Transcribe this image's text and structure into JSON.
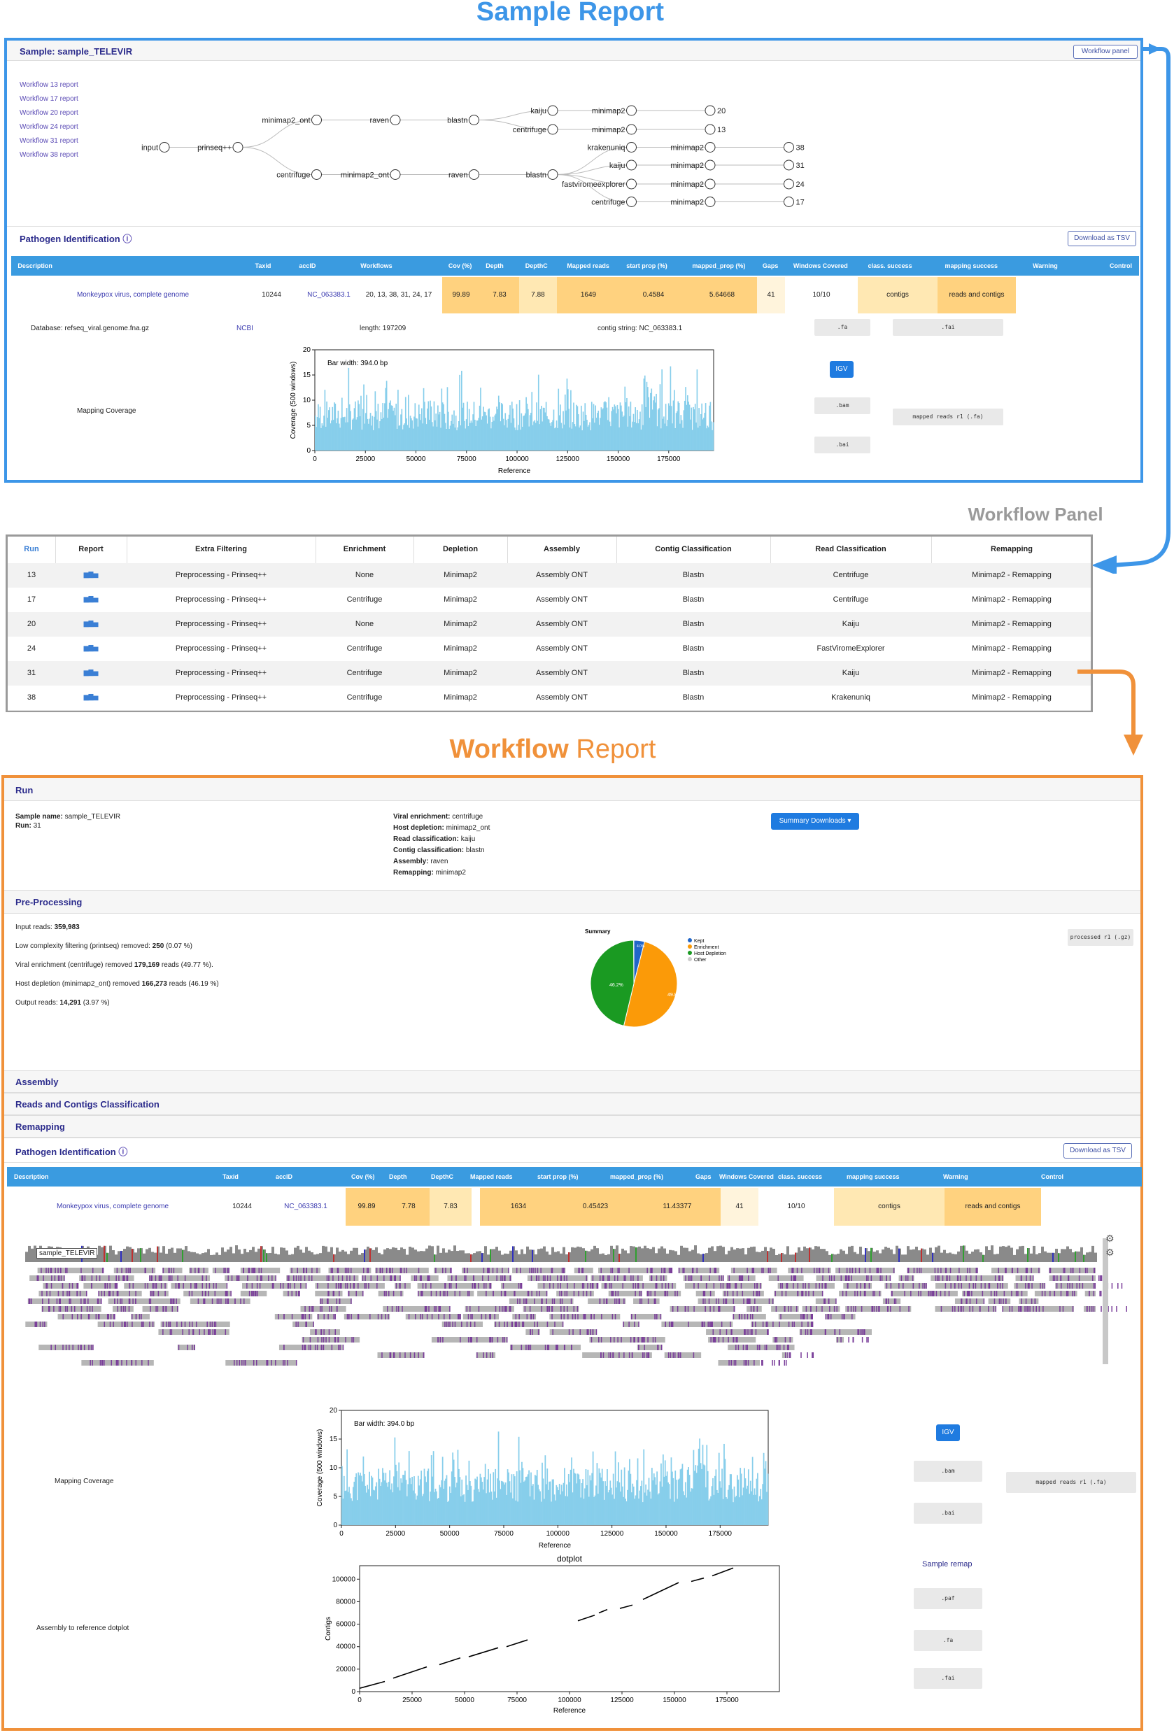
{
  "titles": {
    "sample_report": "Sample Report",
    "workflow_panel": "Workflow Panel",
    "workflow_word": "Workflow",
    "report_word": "Report"
  },
  "sample": {
    "header": "Sample: sample_TELEVIR",
    "workflow_panel_btn": "Workflow panel",
    "workflow_links": [
      "Workflow 13 report",
      "Workflow 17 report",
      "Workflow 20 report",
      "Workflow 24 report",
      "Workflow 31 report",
      "Workflow 38 report"
    ],
    "tree_nodes": {
      "input": "input",
      "prinseq": "prinseq++",
      "minimap2_ont": "minimap2_ont",
      "raven": "raven",
      "blastn": "blastn",
      "kaiju": "kaiju",
      "centrifuge": "centrifuge",
      "minimap2": "minimap2",
      "krakenuniq": "krakenuniq",
      "fastviromeexplorer": "fastviromeexplorer",
      "leaf_20": "20",
      "leaf_13": "13",
      "leaf_38": "38",
      "leaf_31": "31",
      "leaf_24": "24",
      "leaf_17": "17"
    },
    "pathogen_header": "Pathogen Identification",
    "download_tsv": "Download as TSV",
    "columns": [
      "Description",
      "Taxid",
      "accID",
      "Workflows",
      "Cov (%)",
      "Depth",
      "DepthC",
      "Mapped reads",
      "start prop (%)",
      "mapped_prop (%)",
      "Gaps",
      "Windows Covered",
      "class. success",
      "mapping success",
      "Warning",
      "Control"
    ],
    "row": {
      "description": "Monkeypox virus, complete genome",
      "taxid": "10244",
      "accid": "NC_063383.1",
      "workflows": "20, 13, 38, 31, 24, 17",
      "cov": "99.89",
      "depth": "7.83",
      "depthc": "7.88",
      "mapped_reads": "1649",
      "start_prop": "0.4584",
      "mapped_prop": "5.64668",
      "gaps": "41",
      "windows": "10/10",
      "class_success": "contigs",
      "mapping_success": "reads and contigs"
    },
    "detail": {
      "database": "Database: refseq_viral.genome.fna.gz",
      "ncbi": "NCBI",
      "length": "length: 197209",
      "contig_string": "contig string: NC_063383.1",
      "mapping_coverage": "Mapping Coverage",
      "btn_fa": ".fa",
      "btn_fai": ".fai",
      "btn_igv": "IGV",
      "btn_bam": ".bam",
      "btn_bai": ".bai",
      "btn_mapped_reads": "mapped reads r1 (.fa)"
    },
    "coverage_plot": {
      "bar_width": "Bar width: 394.0 bp",
      "ylabel": "Coverage (500 windows)",
      "xlabel": "Reference",
      "yticks": [
        "0",
        "5",
        "10",
        "15",
        "20"
      ],
      "xticks": [
        "0",
        "25000",
        "50000",
        "75000",
        "100000",
        "125000",
        "150000",
        "175000"
      ]
    }
  },
  "panel": {
    "columns": [
      "Run",
      "Report",
      "Extra Filtering",
      "Enrichment",
      "Depletion",
      "Assembly",
      "Contig Classification",
      "Read Classification",
      "Remapping"
    ],
    "rows": [
      {
        "run": "13",
        "filter": "Preprocessing - Prinseq++",
        "enrich": "None",
        "depl": "Minimap2",
        "asm": "Assembly ONT",
        "contig": "Blastn",
        "read": "Centrifuge",
        "remap": "Minimap2 - Remapping"
      },
      {
        "run": "17",
        "filter": "Preprocessing - Prinseq++",
        "enrich": "Centrifuge",
        "depl": "Minimap2",
        "asm": "Assembly ONT",
        "contig": "Blastn",
        "read": "Centrifuge",
        "remap": "Minimap2 - Remapping"
      },
      {
        "run": "20",
        "filter": "Preprocessing - Prinseq++",
        "enrich": "None",
        "depl": "Minimap2",
        "asm": "Assembly ONT",
        "contig": "Blastn",
        "read": "Kaiju",
        "remap": "Minimap2 - Remapping"
      },
      {
        "run": "24",
        "filter": "Preprocessing - Prinseq++",
        "enrich": "Centrifuge",
        "depl": "Minimap2",
        "asm": "Assembly ONT",
        "contig": "Blastn",
        "read": "FastViromeExplorer",
        "remap": "Minimap2 - Remapping"
      },
      {
        "run": "31",
        "filter": "Preprocessing - Prinseq++",
        "enrich": "Centrifuge",
        "depl": "Minimap2",
        "asm": "Assembly ONT",
        "contig": "Blastn",
        "read": "Kaiju",
        "remap": "Minimap2 - Remapping"
      },
      {
        "run": "38",
        "filter": "Preprocessing - Prinseq++",
        "enrich": "Centrifuge",
        "depl": "Minimap2",
        "asm": "Assembly ONT",
        "contig": "Blastn",
        "read": "Krakenuniq",
        "remap": "Minimap2 - Remapping"
      }
    ]
  },
  "report": {
    "run_header": "Run",
    "sample_name_label": "Sample name:",
    "sample_name": "sample_TELEVIR",
    "run_label": "Run:",
    "run": "31",
    "params": [
      {
        "label": "Viral enrichment:",
        "value": "centrifuge"
      },
      {
        "label": "Host depletion:",
        "value": "minimap2_ont"
      },
      {
        "label": "Read classification:",
        "value": "kaiju"
      },
      {
        "label": "Contig classification:",
        "value": "blastn"
      },
      {
        "label": "Assembly:",
        "value": "raven"
      },
      {
        "label": "Remapping:",
        "value": "minimap2"
      }
    ],
    "summary_downloads": "Summary Downloads ▾",
    "preproc_header": "Pre-Processing",
    "preproc": {
      "input_label": "Input reads:",
      "input": "359,983",
      "lowc_label": "Low complexity filtering (printseq) removed:",
      "lowc": "250",
      "lowc_pct": "(0.07 %)",
      "enrich_label": "Viral enrichment (centrifuge) removed",
      "enrich": "179,169",
      "enrich_rest": "reads (49.77 %).",
      "host_label": "Host depletion (minimap2_ont) removed",
      "host": "166,273",
      "host_rest": "reads (46.19 %)",
      "out_label": "Output reads:",
      "out": "14,291",
      "out_pct": "(3.97 %)"
    },
    "pie": {
      "title": "Summary",
      "legend": [
        "Kept",
        "Enrichment",
        "Host Depletion",
        "Other"
      ],
      "colors": [
        "#2166c9",
        "#fb9a08",
        "#1a9a22",
        "#cccccc"
      ],
      "label_depletion": "46.2%",
      "label_enrichment": "49.8%",
      "label_kept": "4.0%"
    },
    "processed_btn": "processed r1 (.gz)",
    "assembly_header": "Assembly",
    "reads_contigs_header": "Reads and Contigs Classification",
    "remapping_header": "Remapping",
    "pathogen_header": "Pathogen Identification",
    "download_tsv": "Download as TSV",
    "columns": [
      "Description",
      "Taxid",
      "accID",
      "Cov (%)",
      "Depth",
      "DepthC",
      "Mapped reads",
      "start prop (%)",
      "mapped_prop (%)",
      "Gaps",
      "Windows Covered",
      "class. success",
      "mapping success",
      "Warning",
      "Control"
    ],
    "row": {
      "description": "Monkeypox virus, complete genome",
      "taxid": "10244",
      "accid": "NC_063383.1",
      "cov": "99.89",
      "depth": "7.78",
      "depthc": "7.83",
      "mapped_reads": "1634",
      "start_prop": "0.45423",
      "mapped_prop": "11.43377",
      "gaps": "41",
      "windows": "10/10",
      "class_success": "contigs",
      "mapping_success": "reads and contigs"
    },
    "igv_track": "sample_TELEVIR",
    "mapping_coverage": "Mapping Coverage",
    "btn_igv": "IGV",
    "btn_bam": ".bam",
    "btn_bai": ".bai",
    "btn_mapped_reads": "mapped reads r1 (.fa)",
    "sample_remap": "Sample remap",
    "btn_paf": ".paf",
    "btn_fa": ".fa",
    "btn_fai": ".fai",
    "assembly_dotplot": "Assembly to reference dotplot",
    "coverage_plot": {
      "bar_width": "Bar width: 394.0 bp",
      "ylabel": "Coverage (500 windows)",
      "xlabel": "Reference",
      "yticks": [
        "0",
        "5",
        "10",
        "15",
        "20"
      ],
      "xticks": [
        "0",
        "25000",
        "50000",
        "75000",
        "100000",
        "125000",
        "150000",
        "175000"
      ]
    },
    "dotplot": {
      "title": "dotplot",
      "ylabel": "Contigs",
      "xlabel": "Reference",
      "yticks": [
        "0",
        "20000",
        "40000",
        "60000",
        "80000",
        "100000"
      ],
      "xticks": [
        "0",
        "25000",
        "50000",
        "75000",
        "100000",
        "125000",
        "150000",
        "175000"
      ]
    }
  },
  "colors": {
    "sample_blue": "#3d96e8",
    "panel_gray": "#9a9a9a",
    "report_orange": "#f0913a",
    "header_blue": "#3a9be0",
    "bar_blue": "#87ceeb",
    "highlight": "#ffd27f",
    "highlight_light": "#ffe8b3"
  }
}
